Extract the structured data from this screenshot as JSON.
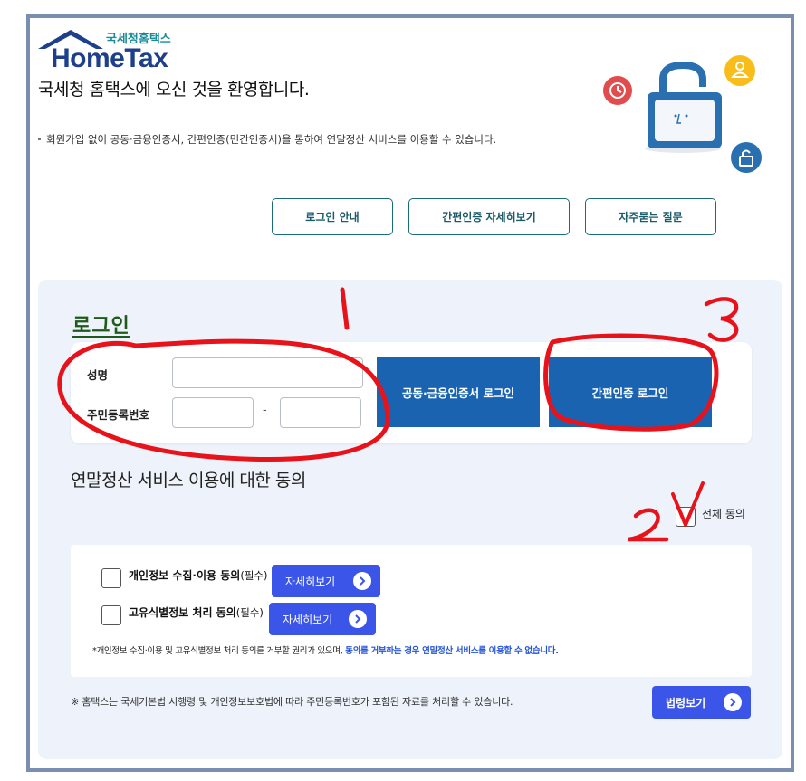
{
  "logo": {
    "kr": "국세청홈택스",
    "en": "HomeTax"
  },
  "header": {
    "welcome": "국세청 홈택스에 오신 것을 환영합니다.",
    "notice": "회원가입 없이 공동·금융인증서, 간편인증(민간인증서)을 통하여 연말정산 서비스를 이용할 수 있습니다."
  },
  "top_buttons": {
    "login_guide": "로그인 안내",
    "simple_auth_detail": "간편인증 자세히보기",
    "faq": "자주묻는 질문"
  },
  "login": {
    "title": "로그인",
    "name_label": "성명",
    "rrn_label": "주민등록번호",
    "rrn_separator": "-",
    "cert_login": "공동·금융인증서 로그인",
    "simple_login": "간편인증 로그인"
  },
  "consent": {
    "title": "연말정산 서비스 이용에 대한 동의",
    "agree_all": "전체 동의",
    "items": [
      {
        "label": "개인정보 수집·이용 동의",
        "required": "(필수)",
        "button": "자세히보기"
      },
      {
        "label": "고유식별정보 처리 동의",
        "required": "(필수)",
        "button": "자세히보기"
      }
    ],
    "note_plain": "*개인정보 수집·이용 및 고유식별정보 처리 동의를 거부할 권리가 있으며, ",
    "note_highlight": "동의를 거부하는 경우 연말정산 서비스를 이용할 수 없습니다."
  },
  "footer": {
    "note": "※ 홈택스는 국세기본법 시행령 및 개인정보보호법에 따라 주민등록번호가 포함된 자료를 처리할 수 있습니다.",
    "law_button": "법령보기"
  },
  "annotations": {
    "one": "1",
    "two": "2",
    "three": "3"
  },
  "colors": {
    "primary_blue": "#1a63b0",
    "detail_blue": "#3a55e8",
    "teal": "#1b6a78",
    "annotation_red": "#e8121b"
  }
}
